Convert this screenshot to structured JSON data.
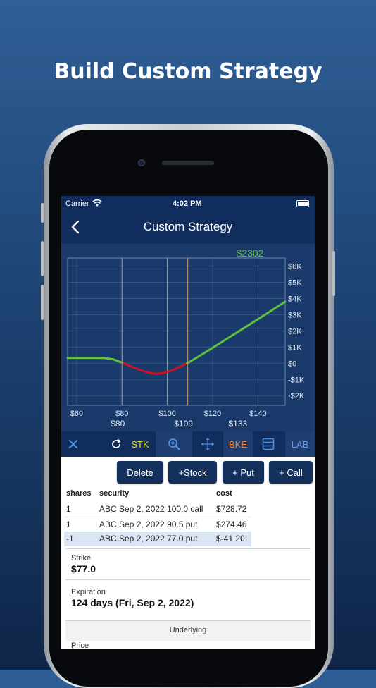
{
  "headline": "Build Custom Strategy",
  "colors": {
    "background_top": "#2f5f96",
    "navbar": "#112d5e",
    "chart_bg": "#1a3a6b",
    "payoff_positive": "#5fc13e",
    "payoff_negative": "#cc1122",
    "price_label": "#5fc13e",
    "stk_label": "#e8d845",
    "bke_label": "#e0884a",
    "lab_label": "#6aa0e8"
  },
  "status_bar": {
    "carrier": "Carrier",
    "time": "4:02 PM"
  },
  "navbar": {
    "title": "Custom Strategy"
  },
  "chart_data": {
    "type": "line",
    "title": "",
    "xlabel": "",
    "ylabel": "",
    "current_value_label": "$2302",
    "x_ticks": [
      "$60",
      "$80",
      "$100",
      "$120",
      "$140"
    ],
    "y_ticks": [
      "$6K",
      "$5K",
      "$4K",
      "$3K",
      "$2K",
      "$1K",
      "$0",
      "-$1K",
      "-$2K"
    ],
    "marker_labels": [
      "$80",
      "$109",
      "$133"
    ],
    "xlim": [
      56,
      152
    ],
    "ylim": [
      -2600,
      6500
    ],
    "marker_lines_x": [
      80,
      100,
      109
    ],
    "series": [
      {
        "points": [
          [
            56,
            330
          ],
          [
            62,
            330
          ],
          [
            68,
            330
          ],
          [
            72,
            320
          ],
          [
            76,
            250
          ],
          [
            80,
            40
          ],
          [
            84,
            -200
          ],
          [
            88,
            -420
          ],
          [
            92,
            -590
          ],
          [
            95,
            -650
          ],
          [
            98,
            -610
          ],
          [
            102,
            -450
          ],
          [
            106,
            -190
          ],
          [
            109,
            20
          ],
          [
            113,
            350
          ],
          [
            118,
            780
          ],
          [
            123,
            1220
          ],
          [
            128,
            1660
          ],
          [
            133,
            2100
          ],
          [
            138,
            2540
          ],
          [
            143,
            2990
          ],
          [
            148,
            3440
          ],
          [
            152,
            3800
          ]
        ]
      }
    ]
  },
  "toolbar": {
    "close_icon": "close-icon",
    "refresh_icon": "refresh-icon",
    "stk_label": "STK",
    "zoom_icon": "zoom-icon",
    "move_icon": "move-icon",
    "bke_label": "BKE",
    "list_icon": "list-icon",
    "lab_label": "LAB"
  },
  "actions": {
    "delete": "Delete",
    "add_stock": "+Stock",
    "add_put": "+ Put",
    "add_call": "+ Call"
  },
  "positions": {
    "headers": {
      "shares": "shares",
      "security": "security",
      "cost": "cost"
    },
    "rows": [
      {
        "shares": "1",
        "security": "ABC Sep 2, 2022 100.0 call",
        "cost": "$728.72"
      },
      {
        "shares": "1",
        "security": "ABC Sep 2, 2022 90.5 put",
        "cost": "$274.46"
      },
      {
        "shares": "-1",
        "security": "ABC Sep 2, 2022 77.0 put",
        "cost": "$-41.20"
      }
    ]
  },
  "details": {
    "strike_label": "Strike",
    "strike_value": "$77.0",
    "expiration_label": "Expiration",
    "expiration_value": "124 days (Fri, Sep 2, 2022)",
    "underlying_label": "Underlying",
    "price_label": "Price"
  }
}
